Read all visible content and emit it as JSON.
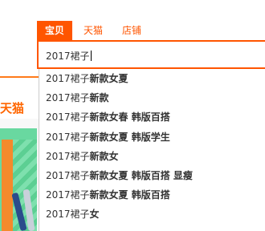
{
  "background": {
    "tmall_label": "天猫"
  },
  "tabs": [
    {
      "label": "宝贝",
      "active": true
    },
    {
      "label": "天猫",
      "active": false
    },
    {
      "label": "店铺",
      "active": false
    }
  ],
  "search": {
    "value": "2017裙子"
  },
  "suggestions": [
    {
      "typed": "2017裙子",
      "rest": "新款女夏"
    },
    {
      "typed": "2017裙子",
      "rest": "新款"
    },
    {
      "typed": "2017裙子",
      "rest": "新款女春 韩版百搭"
    },
    {
      "typed": "2017裙子",
      "rest": "新款女夏 韩版学生"
    },
    {
      "typed": "2017裙子",
      "rest": "新款女"
    },
    {
      "typed": "2017裙子",
      "rest": "新款女夏 韩版百搭 显瘦"
    },
    {
      "typed": "2017裙子",
      "rest": "新款女夏 韩版百搭"
    },
    {
      "typed": "2017裙子",
      "rest": "女"
    }
  ],
  "colors": {
    "accent": "#ff5500"
  }
}
